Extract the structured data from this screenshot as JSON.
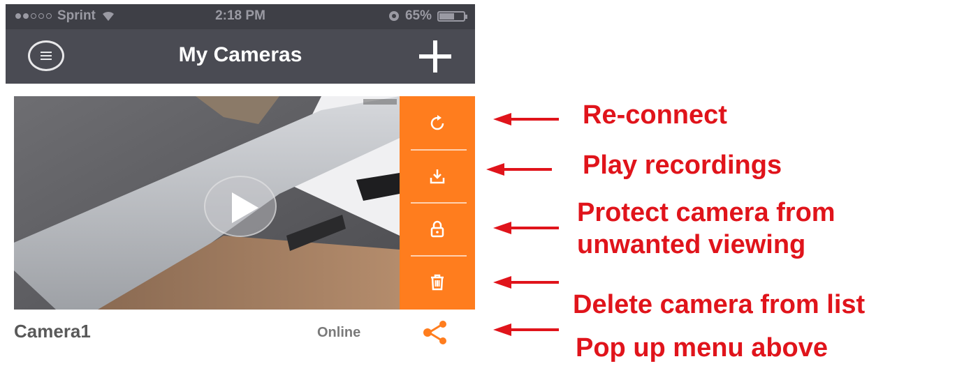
{
  "status_bar": {
    "carrier": "Sprint",
    "time": "2:18 PM",
    "battery": "65%",
    "battery_level": 0.65,
    "signal_bars_filled": 2,
    "signal_bars_total": 5
  },
  "nav": {
    "title": "My Cameras",
    "left_icon": "menu-list-icon",
    "right_icon": "plus-icon"
  },
  "camera": {
    "name": "Camera1",
    "status": "Online",
    "feed_icon": "play-icon",
    "share_icon": "share-icon"
  },
  "actions": [
    {
      "icon": "reconnect-icon"
    },
    {
      "icon": "download-icon"
    },
    {
      "icon": "lock-icon"
    },
    {
      "icon": "trash-icon"
    }
  ],
  "annotations": {
    "reconnect": "Re-connect",
    "recordings": "Play recordings",
    "protect_line1": "Protect camera from",
    "protect_line2": "unwanted viewing",
    "delete": "Delete camera from list",
    "popup": "Pop up menu above"
  },
  "colors": {
    "accent": "#ff7d1e",
    "annotation": "#e0141b",
    "nav_bg": "#4a4b53",
    "status_bg": "#3e3f46"
  }
}
